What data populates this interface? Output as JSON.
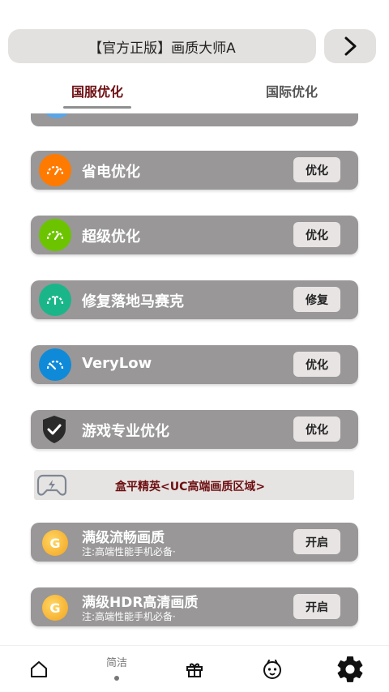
{
  "header": {
    "title": "【官方正版】画质大师A",
    "arrow_icon": "chevron-right-icon"
  },
  "tabs": [
    {
      "label": "国服优化",
      "active": true
    },
    {
      "label": "国际优化",
      "active": false
    }
  ],
  "options": [
    {
      "title": "省电优化",
      "action": "优化",
      "color": "#ff7a00",
      "icon": "gauge-icon"
    },
    {
      "title": "超级优化",
      "action": "优化",
      "color": "#6cc400",
      "icon": "gauge-icon"
    },
    {
      "title": "修复落地马赛克",
      "action": "修复",
      "color": "#1ab68a",
      "icon": "gauge-icon"
    },
    {
      "title": "VeryLow",
      "action": "优化",
      "color": "#0f8ad8",
      "icon": "gauge-icon"
    },
    {
      "title": "游戏专业优化",
      "action": "优化",
      "icon": "shield-check-icon"
    }
  ],
  "banner": {
    "text": "盒平精英<UC高端画质区域>",
    "icon": "gamepad-icon"
  },
  "uc_options": [
    {
      "title": "满级流畅画质",
      "subtitle": "注:高端性能手机必备·",
      "action": "开启",
      "icon": "g-logo-icon"
    },
    {
      "title": "满级HDR高清画质",
      "subtitle": "注:高端性能手机必备·",
      "action": "开启",
      "icon": "g-logo-icon"
    }
  ],
  "bottom_nav": {
    "items": [
      {
        "icon": "home-icon"
      },
      {
        "label": "简洁",
        "active": true
      },
      {
        "icon": "gift-icon"
      },
      {
        "icon": "face-icon"
      },
      {
        "icon": "gear-icon"
      }
    ]
  }
}
